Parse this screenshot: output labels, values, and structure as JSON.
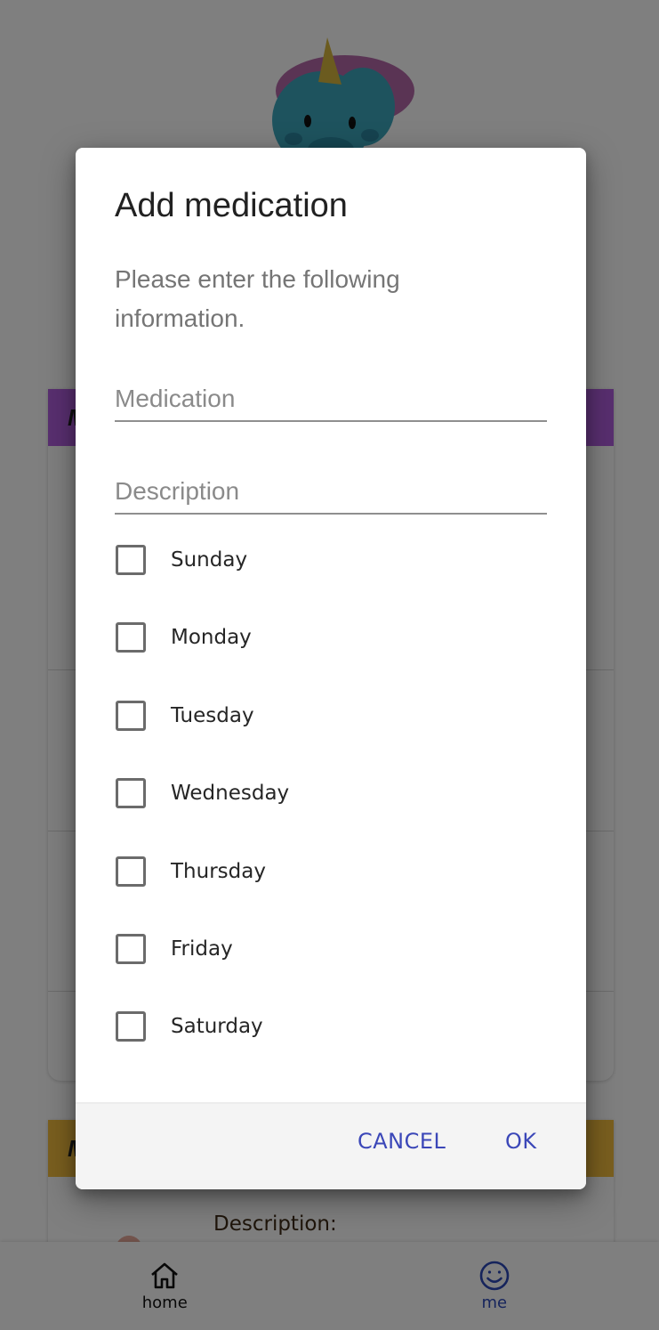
{
  "background": {
    "card1_header_text": "M",
    "card2_header_text": "M",
    "card2_row_description": "Description:"
  },
  "bottom_nav": {
    "items": [
      {
        "label": "home",
        "icon": "home-icon"
      },
      {
        "label": "me",
        "icon": "smiley-icon"
      }
    ]
  },
  "dialog": {
    "title": "Add medication",
    "text": "Please enter the following information.",
    "medication_placeholder": "Medication",
    "description_placeholder": "Description",
    "days": [
      {
        "label": "Sunday",
        "checked": false
      },
      {
        "label": "Monday",
        "checked": false
      },
      {
        "label": "Tuesday",
        "checked": false
      },
      {
        "label": "Wednesday",
        "checked": false
      },
      {
        "label": "Thursday",
        "checked": false
      },
      {
        "label": "Friday",
        "checked": false
      },
      {
        "label": "Saturday",
        "checked": false
      }
    ],
    "cancel_label": "CANCEL",
    "ok_label": "OK"
  },
  "colors": {
    "accent": "#3b47b8",
    "card1_header": "#b35fe0",
    "card2_header": "#f4bf3f"
  }
}
